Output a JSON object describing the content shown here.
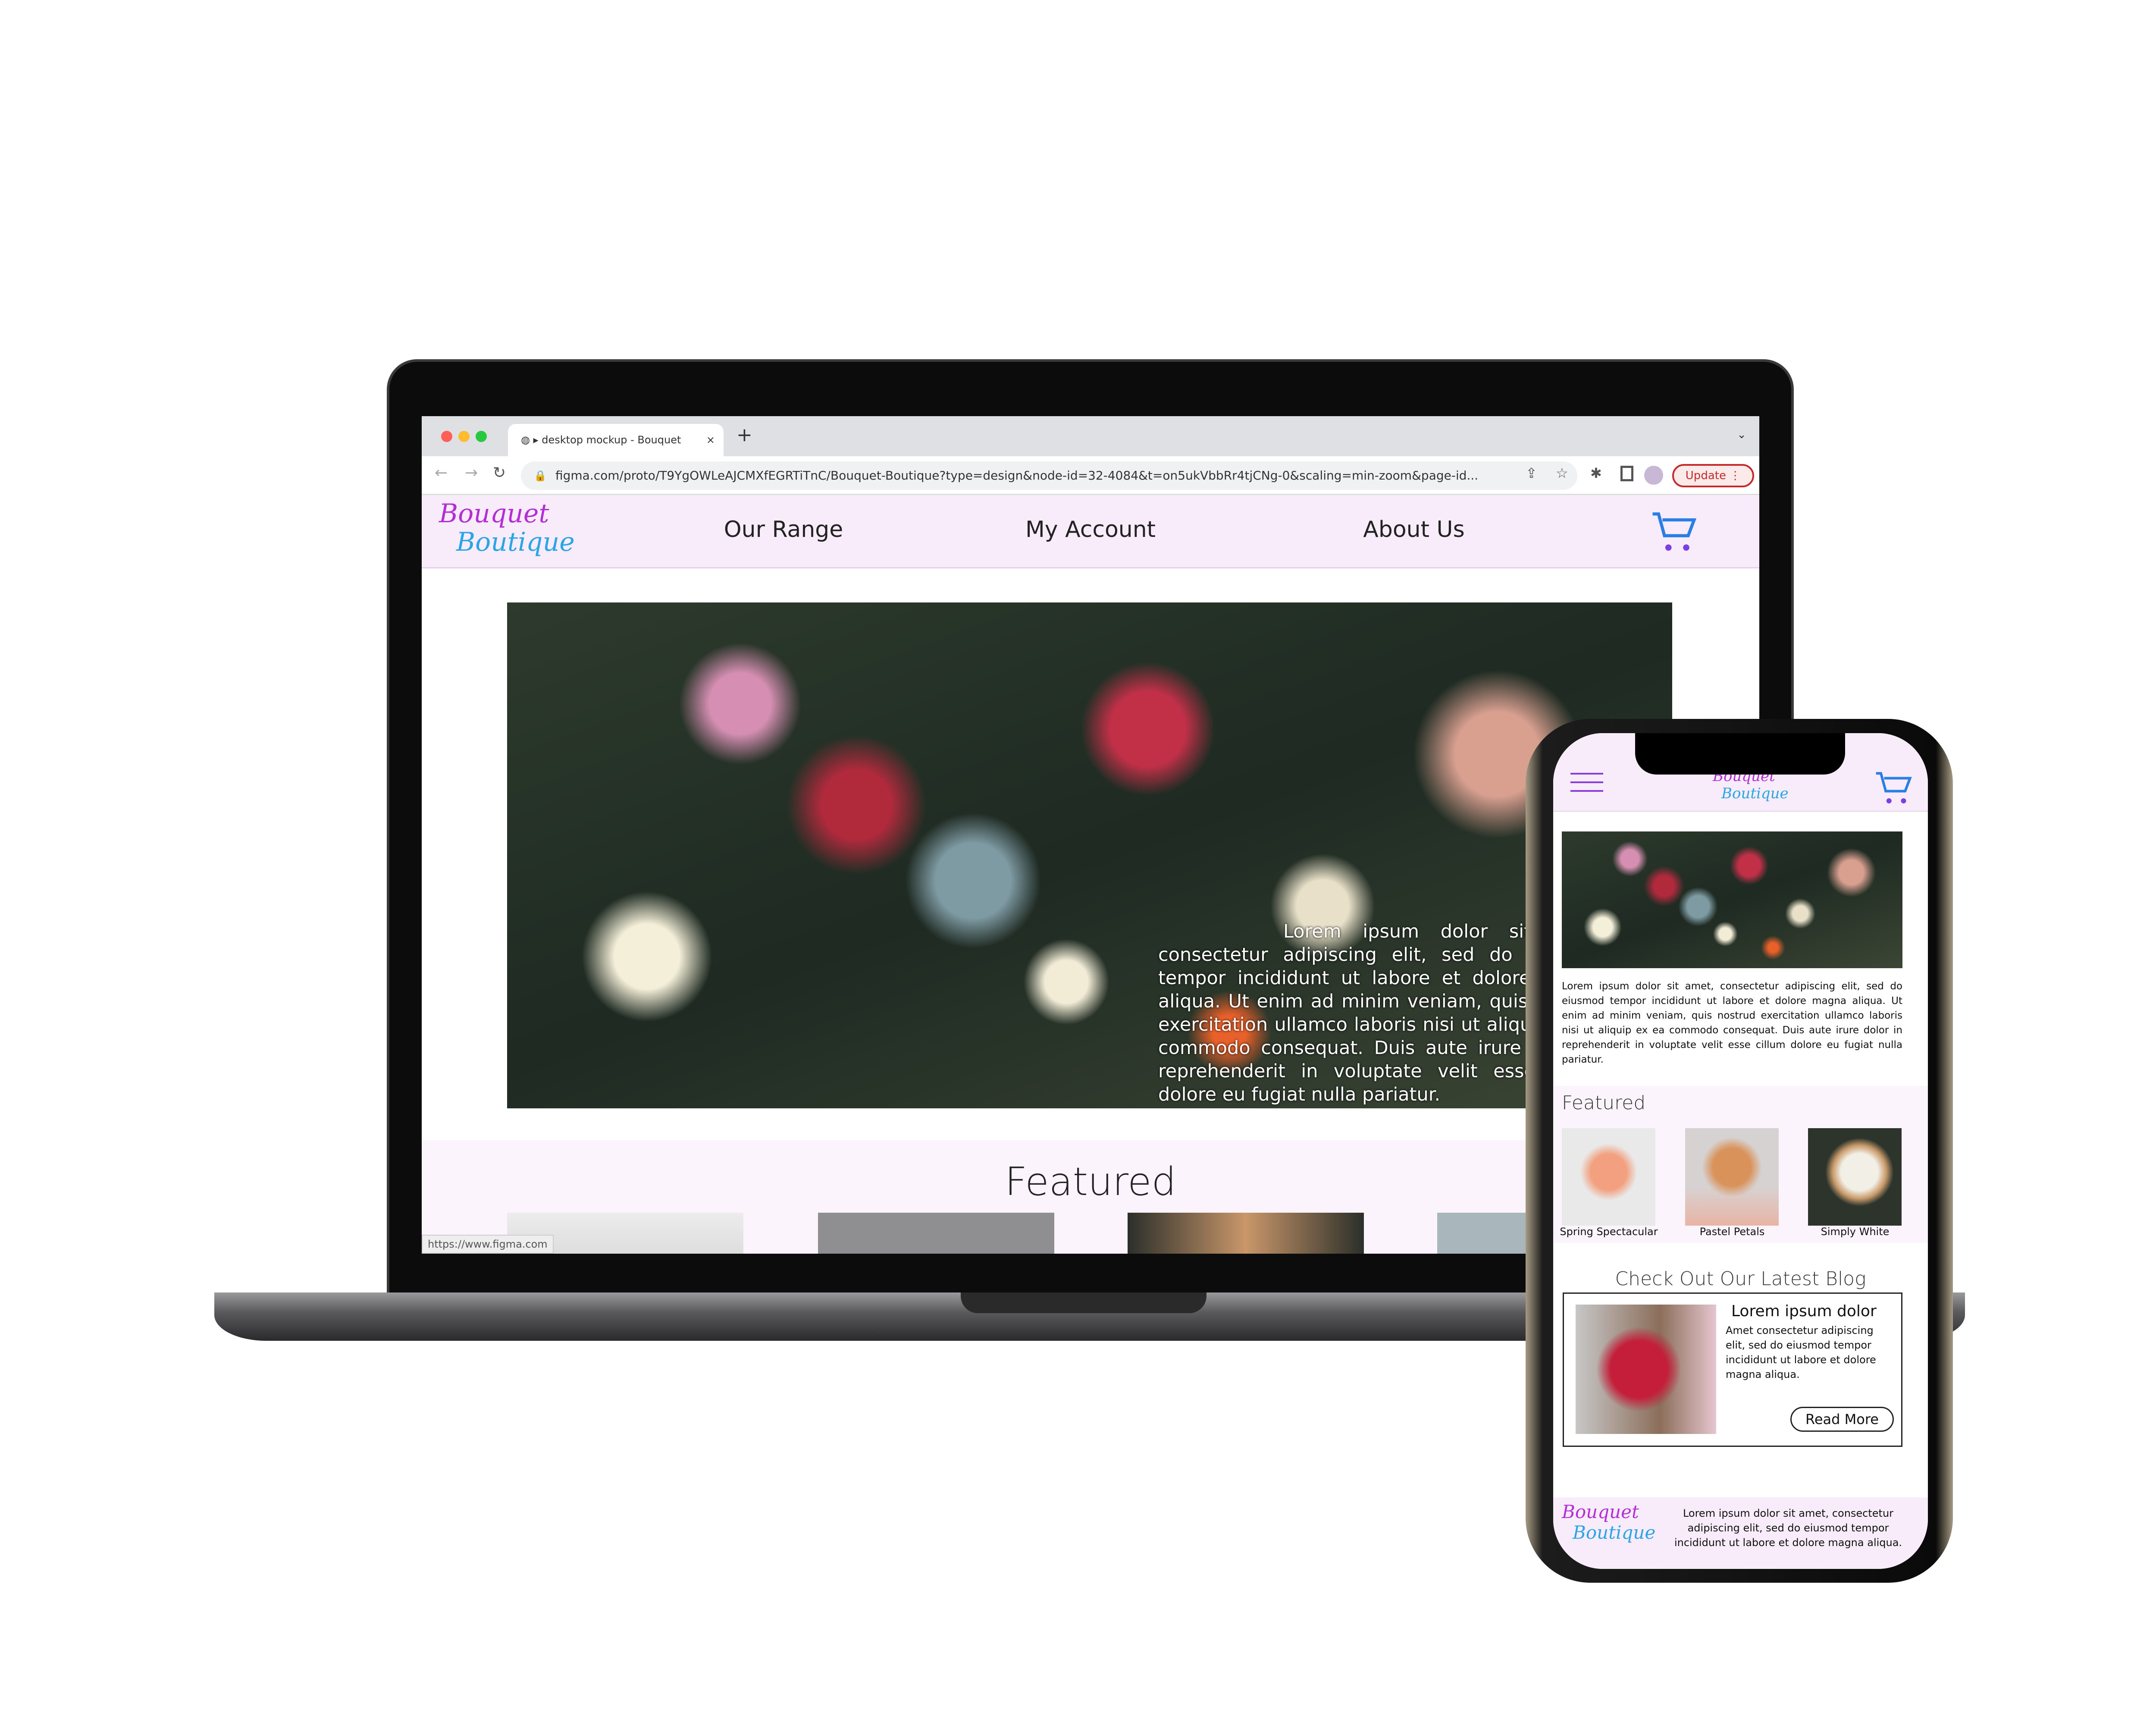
{
  "browser": {
    "tab_title": "▸ desktop mockup - Bouquet",
    "tab_close": "×",
    "new_tab": "+",
    "url": "figma.com/proto/T9YgOWLeAJCMXfEGRTiTnC/Bouquet-Boutique?type=design&node-id=32-4084&t=on5ukVbbRr4tjCNg-0&scaling=min-zoom&page-id...",
    "update_label": "Update",
    "status_url": "https://www.figma.com",
    "traffic_colors": [
      "#ff5f57",
      "#febc2e",
      "#28c840"
    ]
  },
  "site": {
    "logo": {
      "line1": "Bouquet",
      "line2": "Boutique"
    },
    "nav": [
      {
        "label": "Our Range"
      },
      {
        "label": "My Account"
      },
      {
        "label": "About Us"
      }
    ],
    "hero_text": "Lorem ipsum dolor sit amet, consectetur adipiscing elit, sed do eiusmod tempor incididunt ut labore et dolore magna aliqua. Ut enim ad minim veniam, quis nostrud exercitation ullamco laboris nisi ut aliquip ex ea commodo consequat. Duis aute irure dolor in reprehenderit in voluptate velit esse cillum dolore eu fugiat nulla pariatur.",
    "featured_title": "Featured",
    "colors": {
      "brand_purple": "#b42ed6",
      "brand_blue": "#2aa5e6",
      "nav_bg": "#f8ecfb",
      "cart": "#7b3fe4"
    }
  },
  "mobile": {
    "logo": {
      "line1": "Bouquet",
      "line2": "Boutique"
    },
    "intro": "Lorem ipsum dolor sit amet, consectetur adipiscing elit, sed do eiusmod tempor incididunt ut labore et dolore magna aliqua. Ut enim ad minim veniam, quis nostrud exercitation ullamco laboris nisi ut aliquip ex ea commodo consequat. Duis aute irure dolor in reprehenderit in voluptate velit esse cillum dolore eu fugiat nulla pariatur.",
    "featured_title": "Featured",
    "products": [
      {
        "name": "Spring Spectacular"
      },
      {
        "name": "Pastel Petals"
      },
      {
        "name": "Simply White"
      }
    ],
    "blog_section_title": "Check Out Our Latest Blog",
    "blog": {
      "title": "Lorem ipsum dolor",
      "body": "Amet consectetur adipiscing elit, sed do eiusmod tempor incididunt ut labore et dolore magna aliqua.",
      "read_more": "Read More"
    },
    "footer_text": "Lorem ipsum dolor sit amet, consectetur adipiscing elit, sed do eiusmod tempor incididunt ut labore et dolore magna aliqua."
  }
}
